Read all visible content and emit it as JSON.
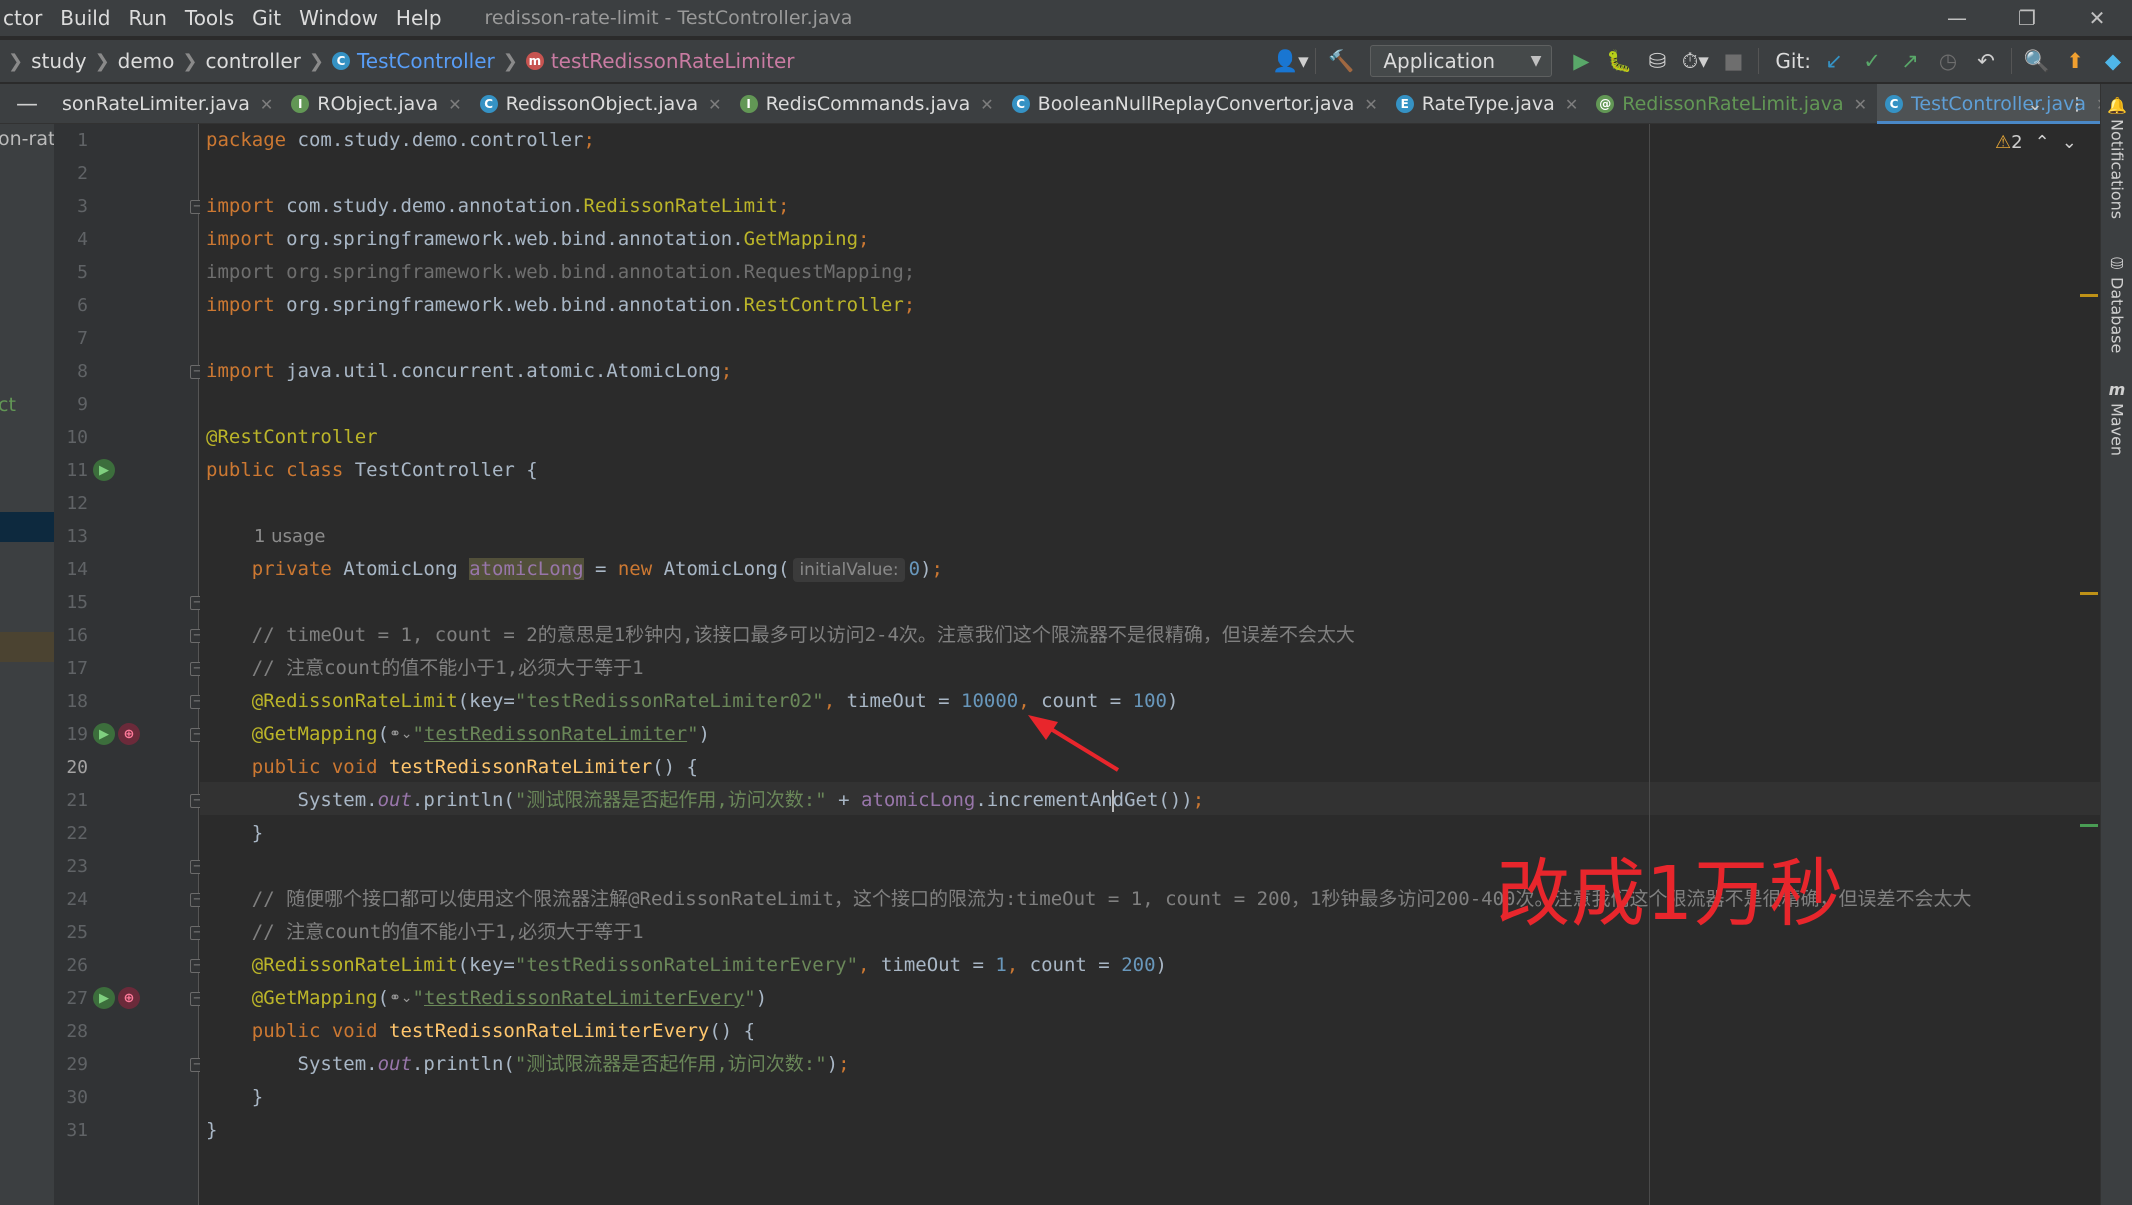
{
  "menubar": {
    "items": [
      "ctor",
      "Build",
      "Run",
      "Tools",
      "Git",
      "Window",
      "Help"
    ],
    "title": "redisson-rate-limit - TestController.java"
  },
  "navbar": {
    "crumbs": [
      "study",
      "demo",
      "controller",
      "TestController",
      "testRedissonRateLimiter"
    ],
    "run_config": "Application",
    "git_label": "Git:"
  },
  "tabs": [
    {
      "label": "sonRateLimiter.java",
      "icon": "class-icon",
      "icon_letter": "",
      "icon_color": "#3592c4",
      "active": false,
      "green": false
    },
    {
      "label": "RObject.java",
      "icon": "interface-icon",
      "icon_letter": "I",
      "icon_color": "#629755",
      "active": false,
      "green": false
    },
    {
      "label": "RedissonObject.java",
      "icon": "class-icon",
      "icon_letter": "C",
      "icon_color": "#3592c4",
      "active": false,
      "green": false
    },
    {
      "label": "RedisCommands.java",
      "icon": "interface-icon",
      "icon_letter": "I",
      "icon_color": "#629755",
      "active": false,
      "green": false
    },
    {
      "label": "BooleanNullReplayConvertor.java",
      "icon": "class-icon",
      "icon_letter": "C",
      "icon_color": "#3592c4",
      "active": false,
      "green": false
    },
    {
      "label": "RateType.java",
      "icon": "enum-icon",
      "icon_letter": "E",
      "icon_color": "#3592c4",
      "active": false,
      "green": false
    },
    {
      "label": "RedissonRateLimit.java",
      "icon": "annotation-icon",
      "icon_letter": "@",
      "icon_color": "#629755",
      "active": false,
      "green": true
    },
    {
      "label": "TestController.java",
      "icon": "class-icon",
      "icon_letter": "C",
      "icon_color": "#3592c4",
      "active": true,
      "green": false
    }
  ],
  "left_panel": {
    "text1": "on-rat",
    "text2": "ct"
  },
  "editor": {
    "usage_hint": "1 usage",
    "param_hint": "initialValue:",
    "warnings_count": "2",
    "current_line": 20
  },
  "annotation_text": "改成1万秒",
  "right_tools": [
    "Notifications",
    "Database",
    "Maven"
  ],
  "colors": {
    "keyword": "#cc7832",
    "string": "#6a8759",
    "number": "#6897bb",
    "annotation": "#bbb529",
    "comment": "#808080",
    "field": "#9876aa",
    "method": "#ffc66d",
    "annotation_overlay": "#e8262c"
  }
}
